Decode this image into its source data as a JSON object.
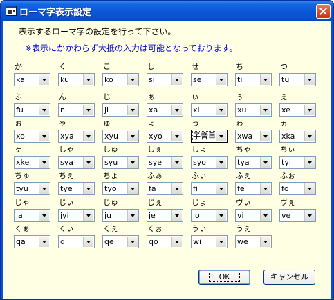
{
  "window": {
    "title": "ローマ字表示設定"
  },
  "instructions": "表示するローマ字の設定を行って下さい。",
  "note": "※表示にかかわらず大抵の入力は可能となっております。",
  "entries": [
    {
      "kana": "か",
      "value": "ka"
    },
    {
      "kana": "く",
      "value": "ku"
    },
    {
      "kana": "こ",
      "value": "ko"
    },
    {
      "kana": "し",
      "value": "si"
    },
    {
      "kana": "せ",
      "value": "se"
    },
    {
      "kana": "ち",
      "value": "ti"
    },
    {
      "kana": "つ",
      "value": "tu"
    },
    {
      "kana": "ふ",
      "value": "fu"
    },
    {
      "kana": "ん",
      "value": "n"
    },
    {
      "kana": "じ",
      "value": "ji"
    },
    {
      "kana": "ぁ",
      "value": "xa"
    },
    {
      "kana": "ぃ",
      "value": "xi"
    },
    {
      "kana": "ぅ",
      "value": "xu"
    },
    {
      "kana": "ぇ",
      "value": "xe"
    },
    {
      "kana": "ぉ",
      "value": "xo"
    },
    {
      "kana": "ゃ",
      "value": "xya"
    },
    {
      "kana": "ゅ",
      "value": "xyu"
    },
    {
      "kana": "ょ",
      "value": "xyo"
    },
    {
      "kana": "っ",
      "value": "子音重"
    },
    {
      "kana": "ゎ",
      "value": "xwa"
    },
    {
      "kana": "ヵ",
      "value": "xka"
    },
    {
      "kana": "ヶ",
      "value": "xke"
    },
    {
      "kana": "しゃ",
      "value": "sya"
    },
    {
      "kana": "しゅ",
      "value": "syu"
    },
    {
      "kana": "しぇ",
      "value": "sye"
    },
    {
      "kana": "しょ",
      "value": "syo"
    },
    {
      "kana": "ちゃ",
      "value": "tya"
    },
    {
      "kana": "ちぃ",
      "value": "tyi"
    },
    {
      "kana": "ちゅ",
      "value": "tyu"
    },
    {
      "kana": "ちぇ",
      "value": "tye"
    },
    {
      "kana": "ちょ",
      "value": "tyo"
    },
    {
      "kana": "ふぁ",
      "value": "fa"
    },
    {
      "kana": "ふぃ",
      "value": "fi"
    },
    {
      "kana": "ふぇ",
      "value": "fe"
    },
    {
      "kana": "ふぉ",
      "value": "fo"
    },
    {
      "kana": "じゃ",
      "value": "ja"
    },
    {
      "kana": "じぃ",
      "value": "jyi"
    },
    {
      "kana": "じゅ",
      "value": "ju"
    },
    {
      "kana": "じぇ",
      "value": "je"
    },
    {
      "kana": "じょ",
      "value": "jo"
    },
    {
      "kana": "ヴぃ",
      "value": "vi"
    },
    {
      "kana": "ヴぇ",
      "value": "ve"
    },
    {
      "kana": "くぁ",
      "value": "qa"
    },
    {
      "kana": "くぃ",
      "value": "qi"
    },
    {
      "kana": "くぇ",
      "value": "qe"
    },
    {
      "kana": "くぉ",
      "value": "qo"
    },
    {
      "kana": "うぃ",
      "value": "wi"
    },
    {
      "kana": "うぇ",
      "value": "we"
    }
  ],
  "buttons": {
    "ok": "OK",
    "cancel": "キャンセル"
  },
  "icons": {
    "title": "app-window-icon",
    "close": "close-icon",
    "dropdown": "chevron-down-icon"
  },
  "colors": {
    "title_bar": "#0a56d6",
    "client_bg": "#ffffe3",
    "note_text": "#0000e0",
    "close_button": "#d5492c"
  }
}
